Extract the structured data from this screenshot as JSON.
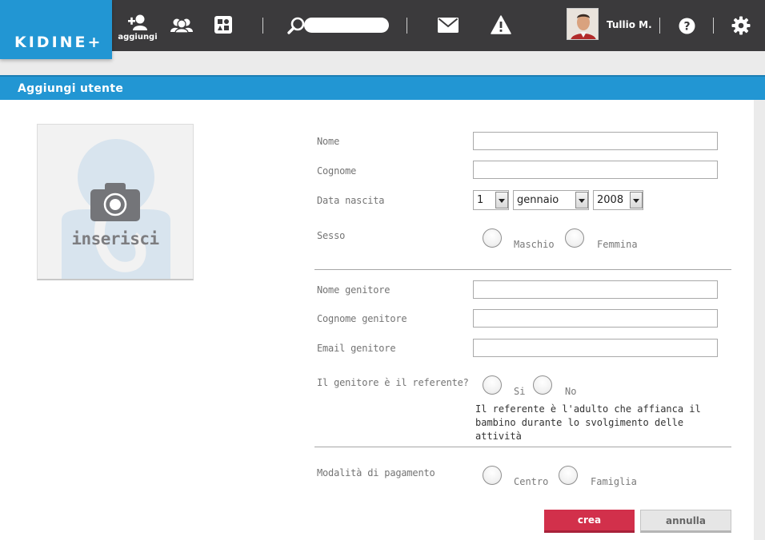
{
  "app": {
    "logo": "KIDINE+"
  },
  "nav": {
    "add_label": "aggiungi",
    "search_placeholder": "",
    "user_name": "Tullio M."
  },
  "panel": {
    "title": "Aggiungi utente"
  },
  "photo": {
    "label": "inserisci"
  },
  "form": {
    "nome_label": "Nome",
    "cognome_label": "Cognome",
    "data_nascita_label": "Data nascita",
    "day_value": "1",
    "month_value": "gennaio",
    "year_value": "2008",
    "sesso_label": "Sesso",
    "sesso_options": [
      "Maschio",
      "Femmina"
    ],
    "nome_genitore_label": "Nome genitore",
    "cognome_genitore_label": "Cognome genitore",
    "email_genitore_label": "Email genitore",
    "referente_label": "Il genitore è il referente?",
    "referente_options": [
      "Si",
      "No"
    ],
    "referente_note": "Il referente è l'adulto che affianca il bambino durante lo svolgimento delle attività",
    "pagamento_label": "Modalità di pagamento",
    "pagamento_options": [
      "Centro",
      "Famiglia"
    ]
  },
  "actions": {
    "create": "crea",
    "cancel": "annulla"
  },
  "colors": {
    "topbar": "#3b3a3c",
    "brand_blue": "#2296d3",
    "create_red": "#d2304b"
  }
}
